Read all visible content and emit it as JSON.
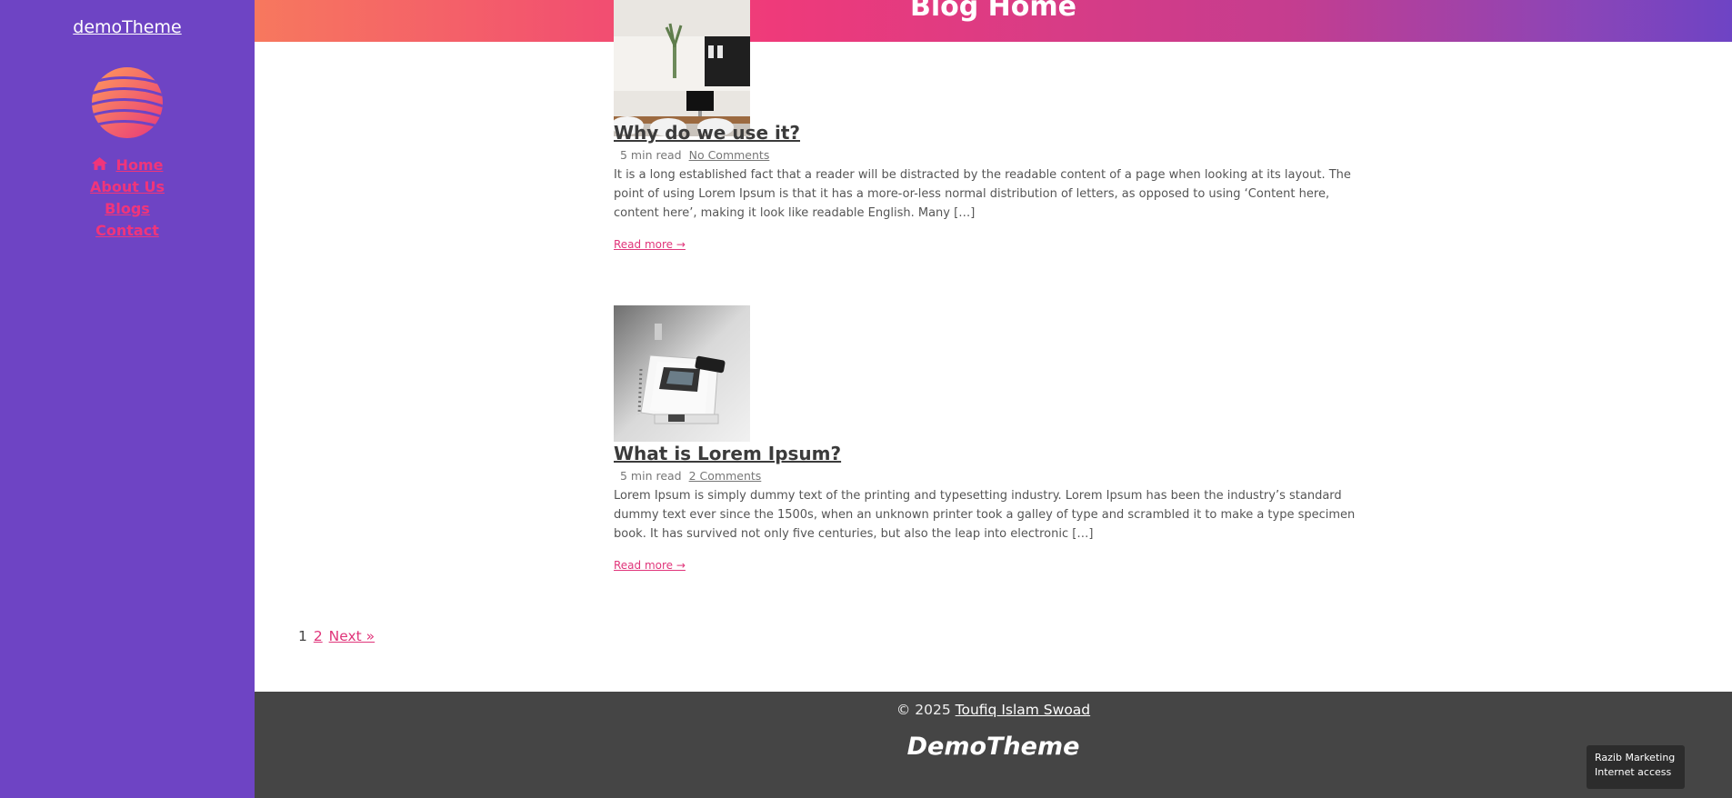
{
  "sidebar": {
    "site_title": "demoTheme",
    "nav": [
      {
        "label": "Home"
      },
      {
        "label": "About Us"
      },
      {
        "label": "Blogs"
      },
      {
        "label": "Contact"
      }
    ]
  },
  "header": {
    "title": "Blog Home"
  },
  "posts": [
    {
      "title": "Why do we use it?",
      "read_time": "5 min read",
      "comments": "No Comments",
      "excerpt": "It is a long established fact that a reader will be distracted by the readable content of a page when looking at its layout. The point of using Lorem Ipsum is that it has a more-or-less normal distribution of letters, as opposed to using ‘Content here, content here’, making it look like readable English. Many […]",
      "read_more": "Read more →"
    },
    {
      "title": "What is Lorem Ipsum?",
      "read_time": "5 min read",
      "comments": "2 Comments",
      "excerpt": "Lorem Ipsum is simply dummy text of the printing and typesetting industry. Lorem Ipsum has been the industry’s standard dummy text ever since the 1500s, when an unknown printer took a galley of type and scrambled it to make a type specimen book. It has survived not only five centuries, but also the leap into electronic […]",
      "read_more": "Read more →"
    }
  ],
  "pagination": {
    "current": "1",
    "page2": "2",
    "next": "Next »"
  },
  "footer": {
    "copyright_prefix": "© 2025",
    "author": "Toufiq Islam Swoad",
    "brand": "DemoTheme"
  },
  "tooltip": {
    "line1": "Razib Marketing",
    "line2": "Internet access"
  },
  "colors": {
    "sidebar": "#6e44c4",
    "accent": "#f0357a",
    "footer": "#454545"
  }
}
